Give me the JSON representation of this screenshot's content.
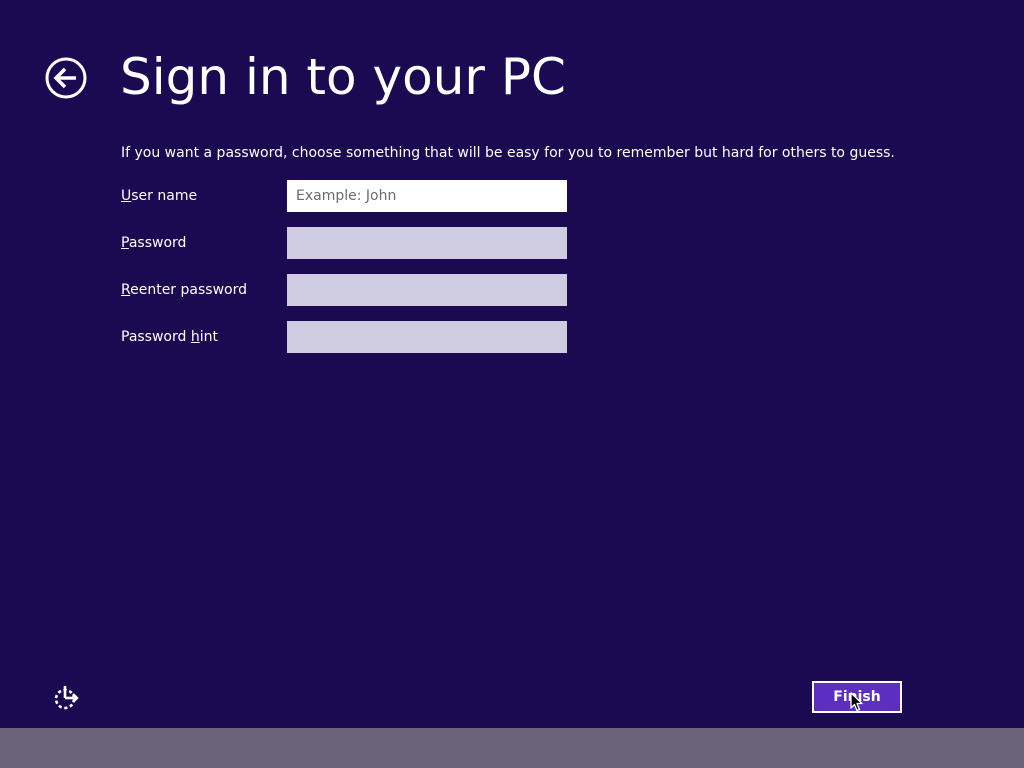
{
  "page": {
    "title": "Sign in to your PC",
    "intro": "If you want a password, choose something that will be easy for you to remember but hard for others to guess."
  },
  "form": {
    "fields": [
      {
        "label_access_key": "U",
        "label_rest": "ser name",
        "value": "",
        "placeholder": "Example: John"
      },
      {
        "label_access_key": "P",
        "label_rest": "assword",
        "value": "",
        "placeholder": ""
      },
      {
        "label_access_key": "R",
        "label_rest": "eenter password",
        "value": "",
        "placeholder": ""
      },
      {
        "label_prefix": "Password ",
        "label_access_key": "h",
        "label_rest": "int",
        "value": "",
        "placeholder": ""
      }
    ]
  },
  "footer": {
    "finish_label": "Finish",
    "ease_of_access_icon": "ease-of-access-icon"
  },
  "icons": {
    "back": "back-arrow-icon",
    "cursor": "mouse-cursor-icon"
  },
  "colors": {
    "background": "#1b0a52",
    "accent_button": "#5c2fc2",
    "taskbar": "#6a6379",
    "input_inactive": "#cfcbe0",
    "input_active": "#ffffff"
  }
}
